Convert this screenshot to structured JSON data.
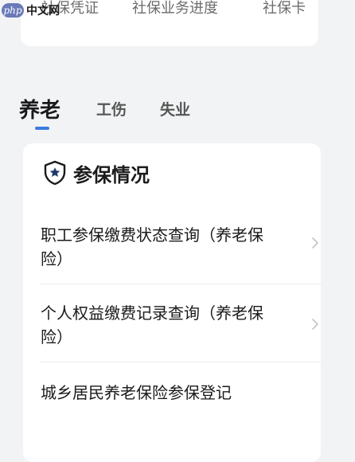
{
  "watermark": {
    "logo": "php",
    "site": "中文网"
  },
  "top_services": {
    "items": [
      {
        "label": "社保凭证"
      },
      {
        "label": "社保业务进度"
      },
      {
        "label": "社保卡"
      }
    ]
  },
  "tabs": [
    {
      "label": "养老",
      "active": true
    },
    {
      "label": "工伤",
      "active": false
    },
    {
      "label": "失业",
      "active": false
    }
  ],
  "section": {
    "title": "参保情况",
    "icon": "shield-star-icon",
    "items": [
      {
        "label": "职工参保缴费状态查询（养老保险）"
      },
      {
        "label": "个人权益缴费记录查询（养老保险）"
      },
      {
        "label": "城乡居民养老保险参保登记"
      }
    ]
  },
  "colors": {
    "accent": "#3a7be0",
    "background": "#f2f3f5",
    "card": "#ffffff",
    "text_primary": "#1a1a1a",
    "text_secondary": "#6b6b6b"
  }
}
